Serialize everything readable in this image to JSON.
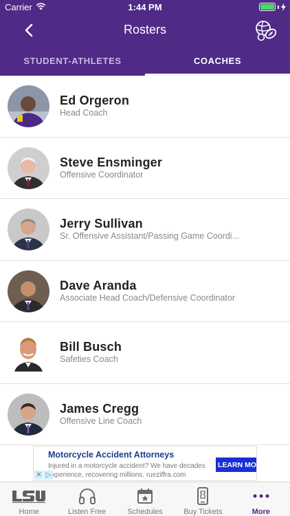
{
  "status_bar": {
    "carrier": "Carrier",
    "time": "1:44 PM"
  },
  "nav": {
    "title": "Rosters",
    "back_icon": "chevron-left-icon",
    "sports_icon": "sports-balls-icon"
  },
  "tabs": [
    {
      "label": "STUDENT-ATHLETES",
      "active": false
    },
    {
      "label": "COACHES",
      "active": true
    }
  ],
  "coaches": [
    {
      "name": "Ed Orgeron",
      "title": "Head Coach"
    },
    {
      "name": "Steve Ensminger",
      "title": "Offensive Coordinator"
    },
    {
      "name": "Jerry Sullivan",
      "title": "Sr. Offensive Assistant/Passing Game Coordi..."
    },
    {
      "name": "Dave Aranda",
      "title": "Associate Head Coach/Defensive Coordinator"
    },
    {
      "name": "Bill Busch",
      "title": "Safeties Coach"
    },
    {
      "name": "James Cregg",
      "title": "Offensive Line Coach"
    }
  ],
  "ad": {
    "headline": "Motorcycle Accident Attorneys",
    "body": "Injured in a motorcycle accident? We have decades experience, recovering millions. rueziffra.com",
    "cta": "LEARN MO"
  },
  "bottom_nav": [
    {
      "label": "Home",
      "icon": "lsu-logo-icon",
      "active": false
    },
    {
      "label": "Listen Free",
      "icon": "headphones-icon",
      "active": false
    },
    {
      "label": "Schedules",
      "icon": "calendar-star-icon",
      "active": false
    },
    {
      "label": "Buy Tickets",
      "icon": "phone-ticket-icon",
      "active": false
    },
    {
      "label": "More",
      "icon": "more-dots-icon",
      "active": true
    }
  ],
  "colors": {
    "brand_purple": "#4f2a87",
    "battery_green": "#4cd964",
    "ad_cta_blue": "#1a2fd6"
  }
}
